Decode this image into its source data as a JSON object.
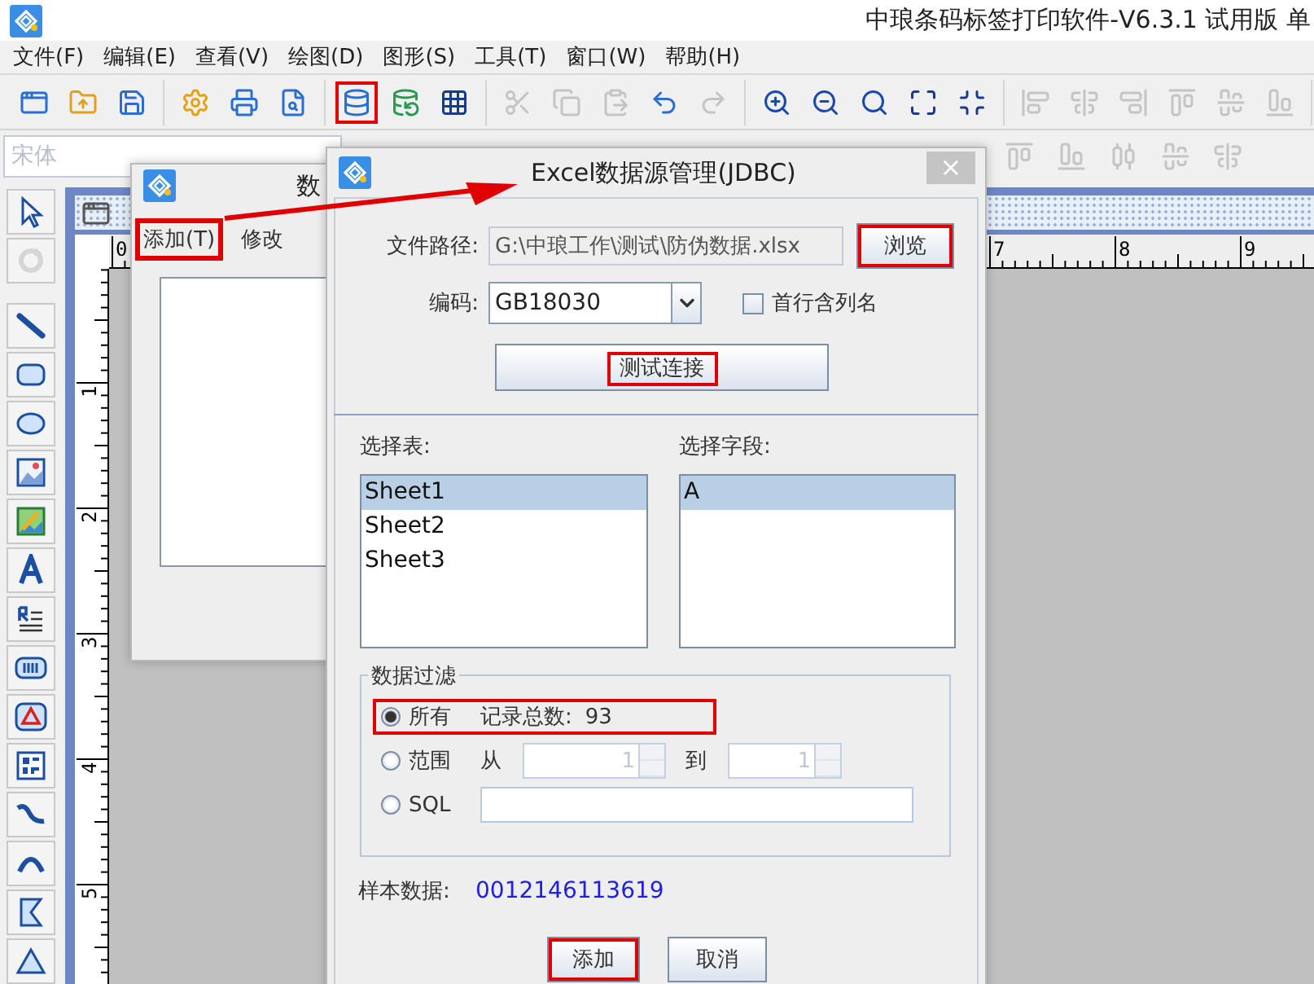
{
  "app_title": "中琅条码标签打印软件-V6.3.1 试用版 单",
  "menu": [
    "文件(F)",
    "编辑(E)",
    "查看(V)",
    "绘图(D)",
    "图形(S)",
    "工具(T)",
    "窗口(W)",
    "帮助(H)"
  ],
  "toolbar_groups": [
    [
      {
        "kind": "window",
        "disabled": false,
        "highlighted": false
      },
      {
        "kind": "open",
        "disabled": false,
        "highlighted": false
      },
      {
        "kind": "save",
        "disabled": false,
        "highlighted": false
      }
    ],
    [
      {
        "kind": "settings",
        "disabled": false,
        "highlighted": false
      },
      {
        "kind": "print",
        "disabled": false,
        "highlighted": false
      },
      {
        "kind": "preview",
        "disabled": false,
        "highlighted": false
      }
    ],
    [
      {
        "kind": "database",
        "disabled": false,
        "highlighted": true
      },
      {
        "kind": "database-check",
        "disabled": false,
        "highlighted": false
      },
      {
        "kind": "grid",
        "disabled": false,
        "highlighted": false
      }
    ],
    [
      {
        "kind": "cut",
        "disabled": true,
        "highlighted": false
      },
      {
        "kind": "copy",
        "disabled": true,
        "highlighted": false
      },
      {
        "kind": "paste",
        "disabled": true,
        "highlighted": false
      },
      {
        "kind": "undo",
        "disabled": false,
        "highlighted": false
      },
      {
        "kind": "redo",
        "disabled": true,
        "highlighted": false
      }
    ],
    [
      {
        "kind": "zoom-in",
        "disabled": false,
        "highlighted": false
      },
      {
        "kind": "zoom-out",
        "disabled": false,
        "highlighted": false
      },
      {
        "kind": "zoom",
        "disabled": false,
        "highlighted": false
      },
      {
        "kind": "fit",
        "disabled": false,
        "highlighted": false
      },
      {
        "kind": "fit-page",
        "disabled": false,
        "highlighted": false
      }
    ],
    [
      {
        "kind": "align-left",
        "disabled": true,
        "highlighted": false
      },
      {
        "kind": "align-center",
        "disabled": true,
        "highlighted": false
      },
      {
        "kind": "align-right",
        "disabled": true,
        "highlighted": false
      },
      {
        "kind": "align-top",
        "disabled": true,
        "highlighted": false
      },
      {
        "kind": "align-middle",
        "disabled": true,
        "highlighted": false
      },
      {
        "kind": "align-bottom",
        "disabled": true,
        "highlighted": false
      }
    ]
  ],
  "font_field": {
    "placeholder": "宋体"
  },
  "format_tools": [
    {
      "kind": "align-top",
      "disabled": true
    },
    {
      "kind": "align-bottom",
      "disabled": true
    },
    {
      "kind": "distribute",
      "disabled": true
    },
    {
      "kind": "align-middle",
      "disabled": true
    },
    {
      "kind": "align-center",
      "disabled": true
    }
  ],
  "tools": [
    {
      "kind": "pointer",
      "disabled": false
    },
    {
      "kind": "rotate",
      "disabled": true
    },
    {
      "kind": "line",
      "disabled": false
    },
    {
      "kind": "rounded-rect",
      "disabled": false
    },
    {
      "kind": "ellipse",
      "disabled": false
    },
    {
      "kind": "image",
      "disabled": false
    },
    {
      "kind": "image-edit",
      "disabled": false
    },
    {
      "kind": "text",
      "disabled": false
    },
    {
      "kind": "rich-text",
      "disabled": false
    },
    {
      "kind": "barcode",
      "disabled": false
    },
    {
      "kind": "triangle-logo",
      "disabled": false
    },
    {
      "kind": "qrcode",
      "disabled": false
    },
    {
      "kind": "curve",
      "disabled": false
    },
    {
      "kind": "arc",
      "disabled": false
    },
    {
      "kind": "flag",
      "disabled": false
    },
    {
      "kind": "triangle",
      "disabled": false
    }
  ],
  "rulers": {
    "horizontal": [
      "0",
      "7",
      "8",
      "9"
    ],
    "vertical": [
      "1",
      "2",
      "3",
      "4",
      "5"
    ]
  },
  "data_dialog": {
    "title": "数",
    "buttons": [
      {
        "label": "添加(T)",
        "highlighted": true
      },
      {
        "label": "修改",
        "highlighted": false
      }
    ]
  },
  "excel_dialog": {
    "title": "Excel数据源管理(JDBC)",
    "close": "×",
    "file_path": {
      "label": "文件路径:",
      "value": "G:\\中琅工作\\测试\\防伪数据.xlsx"
    },
    "browse": {
      "label": "浏览",
      "highlighted": true
    },
    "encoding": {
      "label": "编码:",
      "value": "GB18030"
    },
    "header_row": {
      "label": "首行含列名",
      "checked": false
    },
    "test_button": {
      "label": "测试连接",
      "highlighted": true
    },
    "tables": {
      "label": "选择表:",
      "items": [
        {
          "text": "Sheet1",
          "selected": true
        },
        {
          "text": "Sheet2",
          "selected": false
        },
        {
          "text": "Sheet3",
          "selected": false
        }
      ]
    },
    "fields": {
      "label": "选择字段:",
      "items": [
        {
          "text": "A",
          "selected": true
        }
      ]
    },
    "filter": {
      "legend": "数据过滤",
      "options": [
        {
          "kind": "all",
          "label": "所有",
          "selected": true,
          "highlighted": true,
          "count_label": "记录总数:",
          "count": "93"
        },
        {
          "kind": "range",
          "label": "范围",
          "selected": false,
          "highlighted": false,
          "from_label": "从",
          "from": "1",
          "to_label": "到",
          "to": "1"
        },
        {
          "kind": "sql",
          "label": "SQL",
          "selected": false,
          "highlighted": false
        }
      ]
    },
    "sample": {
      "label": "样本数据:",
      "value": "0012146113619"
    },
    "buttons": [
      {
        "label": "添加",
        "highlighted": true
      },
      {
        "label": "取消",
        "highlighted": false
      }
    ]
  }
}
